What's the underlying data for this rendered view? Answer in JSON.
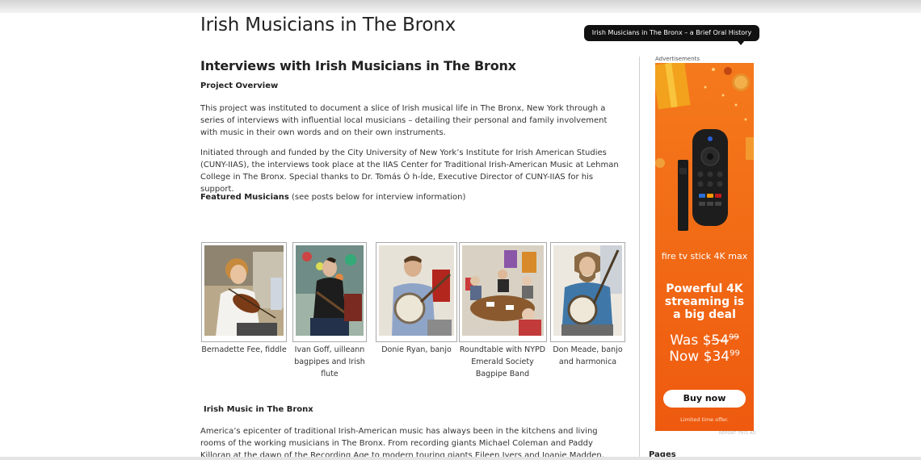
{
  "site": {
    "title": "Irish Musicians in The Bronx",
    "tagline": "Irish Musicians in The Bronx – a Brief Oral History"
  },
  "post": {
    "title": "Interviews with Irish Musicians in The Bronx",
    "overview_heading": "Project Overview",
    "paragraph1": "This project was instituted to document a slice of Irish musical life in The Bronx, New York through a series of  interviews with influential local musicians – detailing their personal and family involvement with music in their own words and on their own instruments.",
    "paragraph2": "Initiated through and funded by the City University of New York’s Institute for Irish American Studies (CUNY-IIAS), the interviews took place at the IIAS Center for Traditional Irish-American Music at Lehman College in The Bronx.  Special thanks to Dr. Tomás Ó h-Íde, Executive Director of CUNY-IIAS for his support.",
    "featured_label": "Featured Musicians",
    "featured_note": " (see posts below for interview information)",
    "musicians": [
      {
        "caption": "Bernadette Fee, fiddle"
      },
      {
        "caption": "Ivan Goff, uilleann bagpipes and Irish flute"
      },
      {
        "caption": "Donie Ryan, banjo"
      },
      {
        "caption": "Roundtable with NYPD Emerald Society Bagpipe Band"
      },
      {
        "caption": "Don Meade, banjo and harmonica"
      }
    ],
    "section_heading": "Irish Music in The Bronx",
    "paragraph3": "America’s epicenter of traditional Irish-American music has always been in the kitchens and living rooms of the working musicians in The Bronx. From recording giants Michael Coleman and Paddy Killoran at the dawn of the Recording Age to modern touring giants Eileen Ivers and Joanie Madden, musicians have learned"
  },
  "sidebar": {
    "ad_label": "Advertisements",
    "ad": {
      "brand": "fire tv stick 4K max",
      "headline": "Powerful 4K streaming is a big deal",
      "was_label": "Was $",
      "was_dollars": "54",
      "was_cents": "99",
      "now_label": "Now $",
      "now_dollars": "34",
      "now_cents": "99",
      "cta": "Buy now",
      "footnote": "Limited time offer.",
      "report": "REPORT THIS AD"
    },
    "pages_heading": "Pages"
  },
  "colors": {
    "ad_background": "#f05a10",
    "pill_background": "#111111",
    "text": "#333333"
  }
}
